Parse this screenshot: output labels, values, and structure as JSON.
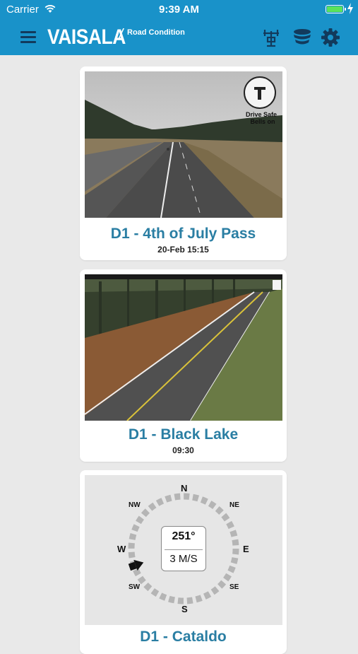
{
  "status_bar": {
    "carrier": "Carrier",
    "time": "9:39 AM"
  },
  "header": {
    "brand": "VAISALA",
    "slash": "/",
    "subtitle": "Road Condition"
  },
  "cameras": [
    {
      "title": "D1 - 4th of July Pass",
      "timestamp": "20-Feb 15:15",
      "watermark": "Drive Safe Bells on"
    },
    {
      "title": "D1 - Black Lake",
      "timestamp": "09:30"
    }
  ],
  "wind_card": {
    "title": "D1 - Cataldo",
    "direction": "251°",
    "direction_degrees": 251,
    "speed": "3 M/S",
    "compass": {
      "n": "N",
      "ne": "NE",
      "e": "E",
      "se": "SE",
      "s": "S",
      "sw": "SW",
      "w": "W",
      "nw": "NW"
    }
  },
  "colors": {
    "header": "#1992c9",
    "title": "#2a7ea3",
    "background": "#e9e9e9"
  },
  "icons": [
    "menu-icon",
    "weather-station-icon",
    "layers-icon",
    "settings-gear-icon"
  ]
}
